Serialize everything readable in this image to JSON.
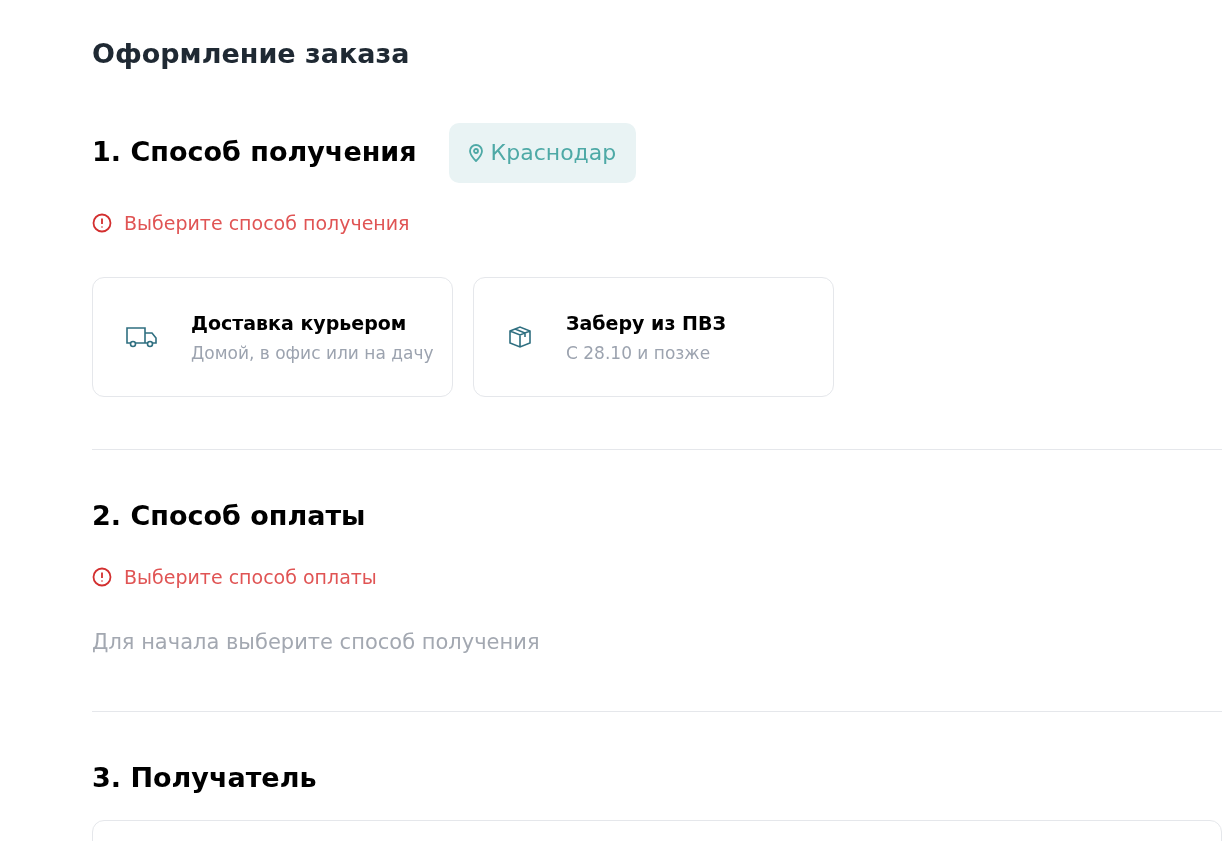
{
  "title": "Оформление заказа",
  "sections": [
    {
      "heading": "1. Способ получения",
      "city": "Краснодар",
      "error": "Выберите способ получения",
      "options": [
        {
          "kind": "courier",
          "title": "Доставка курьером",
          "subtitle": "Домой, в офис или на дачу",
          "selected": false
        },
        {
          "kind": "pickup",
          "title": "Заберу из ПВЗ",
          "subtitle": "С 28.10 и позже",
          "selected": false
        }
      ]
    },
    {
      "heading": "2. Способ оплаты",
      "error": "Выберите способ оплаты",
      "hint": "Для начала выберите способ получения"
    },
    {
      "heading": "3. Получатель"
    }
  ]
}
